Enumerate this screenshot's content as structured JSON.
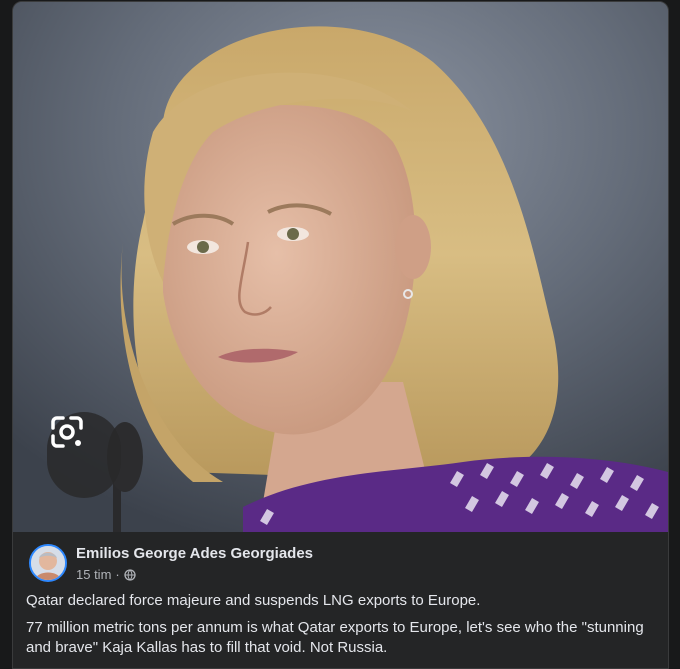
{
  "post": {
    "author": "Emilios George Ades Georgiades",
    "time": "15 tim",
    "separator": "·",
    "privacy_icon": "globe-icon",
    "paragraphs": [
      "Qatar declared force majeure and suspends LNG exports to Europe.",
      "77 million metric tons per annum is what Qatar exports to Europe, let's see who the \"stunning and brave\" Kaja Kallas has to fill that void. Not Russia."
    ]
  },
  "overlay": {
    "lens_icon": "google-lens-camera-icon"
  },
  "colors": {
    "background": "#18191a",
    "card": "#242526",
    "text_primary": "#e4e6eb",
    "text_secondary": "#b0b3b8",
    "avatar_ring": "#2d88ff"
  }
}
